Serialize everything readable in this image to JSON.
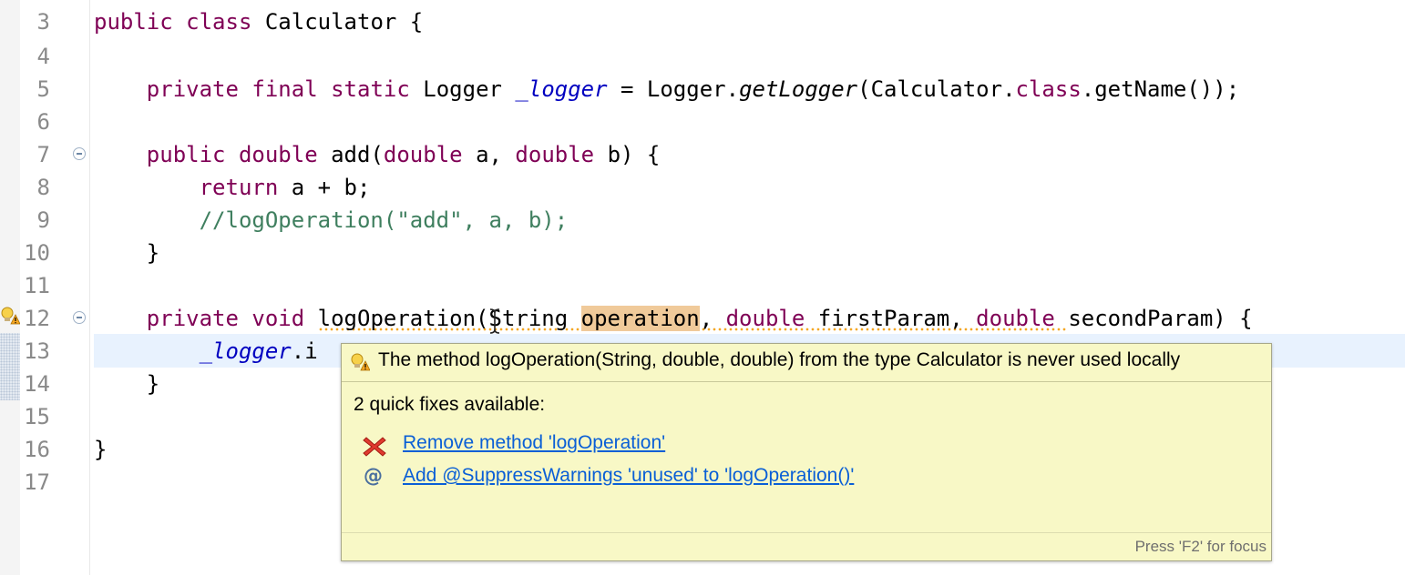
{
  "editor": {
    "line_numbers": [
      "3",
      "4",
      "5",
      "6",
      "7",
      "8",
      "9",
      "10",
      "11",
      "12",
      "13",
      "14",
      "15",
      "16",
      "17"
    ],
    "lines": {
      "l3": {
        "kw1": "public",
        "kw2": "class",
        "name": "Calculator {"
      },
      "l5": {
        "kw1": "private",
        "kw2": "final",
        "kw3": "static",
        "type": "Logger",
        "field": "_logger",
        "assign": "= Logger.",
        "method": "getLogger",
        "args_a": "(Calculator.",
        "kw4": "class",
        "args_b": ".getName());"
      },
      "l7": {
        "kw1": "public",
        "kw2": "double",
        "name": "add(",
        "kw3": "double",
        "p1": "a,",
        "kw4": "double",
        "p2": "b) {"
      },
      "l8": {
        "kw": "return",
        "expr": "a + b;"
      },
      "l9": {
        "comment": "//logOperation(\"add\", a, b);"
      },
      "l10": {
        "text": "}"
      },
      "l12": {
        "kw1": "private",
        "kw2": "void",
        "method": "logOperation",
        "open": "(String",
        "param": "operation",
        "comma": ",",
        "kw3": "double",
        "p2": "firstParam,",
        "kw4": "double",
        "p3": "secondParam) {"
      },
      "l13": {
        "field": "_logger",
        "rest": ".i"
      },
      "l14": {
        "text": "}"
      },
      "l16": {
        "text": "}"
      }
    }
  },
  "quickfix_popup": {
    "title": "The method logOperation(String, double, double) from the type Calculator is never used locally",
    "fixes_label": "2 quick fixes available:",
    "fixes": [
      {
        "label": "Remove method 'logOperation'",
        "icon": "remove-x-icon"
      },
      {
        "label": "Add @SuppressWarnings 'unused' to 'logOperation()'",
        "icon": "annotation-at-icon"
      }
    ],
    "focus_hint": "Press 'F2' for focus"
  },
  "colors": {
    "keyword": "#7f0055",
    "field": "#0000c0",
    "comment": "#3f7f5f",
    "link": "#0a5fd6",
    "popup_bg": "#f8f8c6",
    "current_line": "#e8f2fe",
    "occurrence_highlight": "#f0ca9a",
    "warning": "#f5a623"
  }
}
